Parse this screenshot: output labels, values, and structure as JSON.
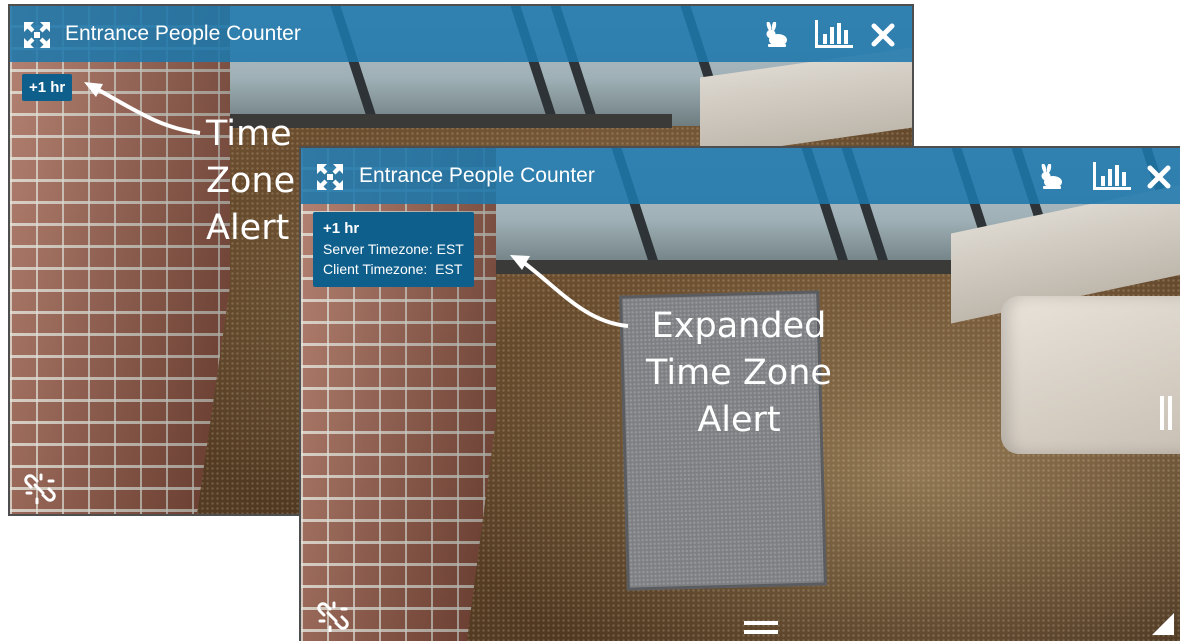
{
  "panels": [
    {
      "title": "Entrance People Counter",
      "alert_badge": "+1 hr",
      "annotation_lines": [
        "Time",
        "Zone",
        "Alert"
      ]
    },
    {
      "title": "Entrance People Counter",
      "alert_expanded": {
        "header": "+1 hr",
        "server_label": "Server Timezone:",
        "server_value": "EST",
        "client_label": "Client Timezone:",
        "client_value": "EST"
      },
      "annotation_lines": [
        "Expanded",
        "Time Zone",
        "Alert"
      ]
    }
  ],
  "icons": {
    "expand": "expand-arrows-icon",
    "speed": "rabbit-icon",
    "analytics": "bar-chart-icon",
    "close": "close-icon",
    "unlink": "broken-link-icon",
    "pause": "pause-icon",
    "menu": "hamburger-menu-icon",
    "resize": "resize-corner-icon"
  },
  "colors": {
    "titlebar": "#1e78ac",
    "alert": "#0f5f8c",
    "annotation_text": "#ffffff"
  }
}
